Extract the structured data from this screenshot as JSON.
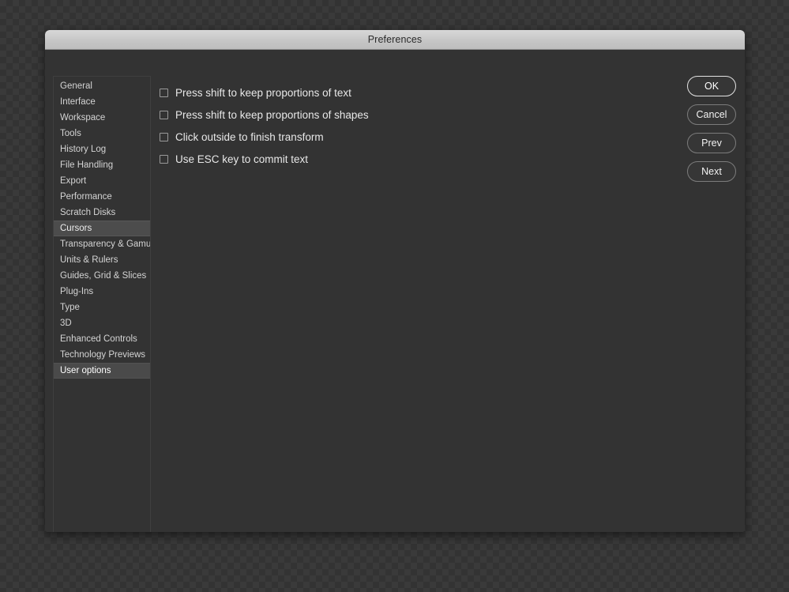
{
  "window": {
    "title": "Preferences"
  },
  "sidebar": {
    "items": [
      {
        "label": "General",
        "state": "normal"
      },
      {
        "label": "Interface",
        "state": "normal"
      },
      {
        "label": "Workspace",
        "state": "normal"
      },
      {
        "label": "Tools",
        "state": "normal"
      },
      {
        "label": "History Log",
        "state": "normal"
      },
      {
        "label": "File Handling",
        "state": "normal"
      },
      {
        "label": "Export",
        "state": "normal"
      },
      {
        "label": "Performance",
        "state": "normal"
      },
      {
        "label": "Scratch Disks",
        "state": "normal"
      },
      {
        "label": "Cursors",
        "state": "hovered"
      },
      {
        "label": "Transparency & Gamut",
        "state": "normal"
      },
      {
        "label": "Units & Rulers",
        "state": "normal"
      },
      {
        "label": "Guides, Grid & Slices",
        "state": "normal"
      },
      {
        "label": "Plug-Ins",
        "state": "normal"
      },
      {
        "label": "Type",
        "state": "normal"
      },
      {
        "label": "3D",
        "state": "normal"
      },
      {
        "label": "Enhanced Controls",
        "state": "normal"
      },
      {
        "label": "Technology Previews",
        "state": "normal"
      },
      {
        "label": "User options",
        "state": "selected"
      }
    ]
  },
  "options": [
    {
      "label": "Press shift to keep proportions of text",
      "checked": false
    },
    {
      "label": "Press shift to keep proportions of shapes",
      "checked": false
    },
    {
      "label": "Click outside to finish transform",
      "checked": false
    },
    {
      "label": "Use ESC key to commit text",
      "checked": false
    }
  ],
  "buttons": [
    {
      "label": "OK",
      "variant": "default"
    },
    {
      "label": "Cancel",
      "variant": "secondary"
    },
    {
      "label": "Prev",
      "variant": "secondary"
    },
    {
      "label": "Next",
      "variant": "secondary"
    }
  ],
  "colors": {
    "dialog_background": "#333333",
    "titlebar_top": "#d8d8d8",
    "selected_row": "#4a4a4a",
    "text_primary": "#e8e8e8"
  }
}
